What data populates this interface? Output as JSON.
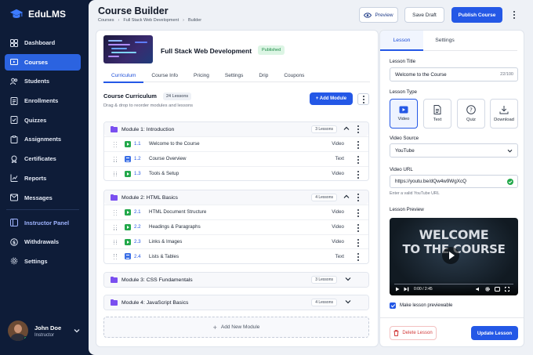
{
  "brand": {
    "name": "EduLMS"
  },
  "nav": {
    "items": [
      {
        "label": "Dashboard",
        "icon": "dashboard-icon"
      },
      {
        "label": "Courses",
        "icon": "courses-icon",
        "active": true
      },
      {
        "label": "Students",
        "icon": "students-icon"
      },
      {
        "label": "Enrollments",
        "icon": "enrollments-icon"
      },
      {
        "label": "Quizzes",
        "icon": "quizzes-icon"
      },
      {
        "label": "Assignments",
        "icon": "assignments-icon"
      },
      {
        "label": "Certificates",
        "icon": "certificates-icon"
      },
      {
        "label": "Reports",
        "icon": "reports-icon"
      },
      {
        "label": "Messages",
        "icon": "messages-icon"
      }
    ],
    "items2": [
      {
        "label": "Instructor Panel",
        "icon": "instructor-icon"
      },
      {
        "label": "Withdrawals",
        "icon": "withdrawals-icon"
      },
      {
        "label": "Settings",
        "icon": "settings-icon"
      }
    ]
  },
  "user": {
    "name": "John Doe",
    "role": "Instructor"
  },
  "header": {
    "title": "Course Builder",
    "breadcrumb": [
      "Courses",
      "Full Stack Web Development",
      "Builder"
    ],
    "preview_label": "Preview",
    "save_draft_label": "Save Draft",
    "publish_label": "Publish Course"
  },
  "course": {
    "name": "Full Stack Web Development",
    "status": "Published",
    "tabs": [
      "Curriculum",
      "Course Info",
      "Pricing",
      "Settings",
      "Drip",
      "Coupons"
    ],
    "active_tab": "Curriculum"
  },
  "curriculum": {
    "title": "Course Curriculum",
    "count": "24 Lessons",
    "subtitle": "Drag & drop to reorder modules and lessons",
    "add_module_label": "+ Add Module",
    "add_new_module_label": "Add New Module",
    "modules": [
      {
        "title": "Module 1: Introduction",
        "count": "3 Lessons",
        "expanded": true,
        "lessons": [
          {
            "num": "1.1",
            "name": "Welcome to the Course",
            "type": "Video"
          },
          {
            "num": "1.2",
            "name": "Course Overview",
            "type": "Text"
          },
          {
            "num": "1.3",
            "name": "Tools & Setup",
            "type": "Video"
          }
        ]
      },
      {
        "title": "Module 2: HTML Basics",
        "count": "4 Lessons",
        "expanded": true,
        "lessons": [
          {
            "num": "2.1",
            "name": "HTML Document Structure",
            "type": "Video"
          },
          {
            "num": "2.2",
            "name": "Headings & Paragraphs",
            "type": "Video"
          },
          {
            "num": "2.3",
            "name": "Links & Images",
            "type": "Video"
          },
          {
            "num": "2.4",
            "name": "Lists & Tables",
            "type": "Text"
          }
        ]
      },
      {
        "title": "Module 3: CSS Fundamentals",
        "count": "3 Lessons",
        "expanded": false,
        "lessons": []
      },
      {
        "title": "Module 4: JavaScript Basics",
        "count": "4 Lessons",
        "expanded": false,
        "lessons": []
      }
    ]
  },
  "panel": {
    "tabs": [
      "Lesson",
      "Settings"
    ],
    "lesson_title_label": "Lesson Title",
    "lesson_title_value": "Welcome to the Course",
    "lesson_title_count": "22/100",
    "lesson_type_label": "Lesson Type",
    "types": [
      {
        "label": "Video",
        "icon": "video-icon",
        "active": true
      },
      {
        "label": "Text",
        "icon": "text-doc-icon"
      },
      {
        "label": "Quiz",
        "icon": "quiz-icon"
      },
      {
        "label": "Download",
        "icon": "download-icon"
      }
    ],
    "video_source_label": "Video Source",
    "video_source_value": "YouTube",
    "video_url_label": "Video URL",
    "video_url_value": "https://youtu.be/dQw4w9WgXcQ",
    "video_url_hint": "Enter a valid YouTube URL",
    "preview_label": "Lesson Preview",
    "preview_text_line1": "WELCOME",
    "preview_text_line2": "TO THE COURSE",
    "preview_time": "0:00 / 2:45",
    "previewable_label": "Make lesson previewable",
    "delete_label": "Delete Lesson",
    "update_label": "Update Lesson"
  },
  "colors": {
    "accent": "#2458e6",
    "sidebar": "#0e1c38",
    "published": "#1b8a45",
    "video": "#22a84a",
    "text": "#3b6fe6",
    "module_icon": "#7a4ff0",
    "danger": "#d23b3b"
  }
}
